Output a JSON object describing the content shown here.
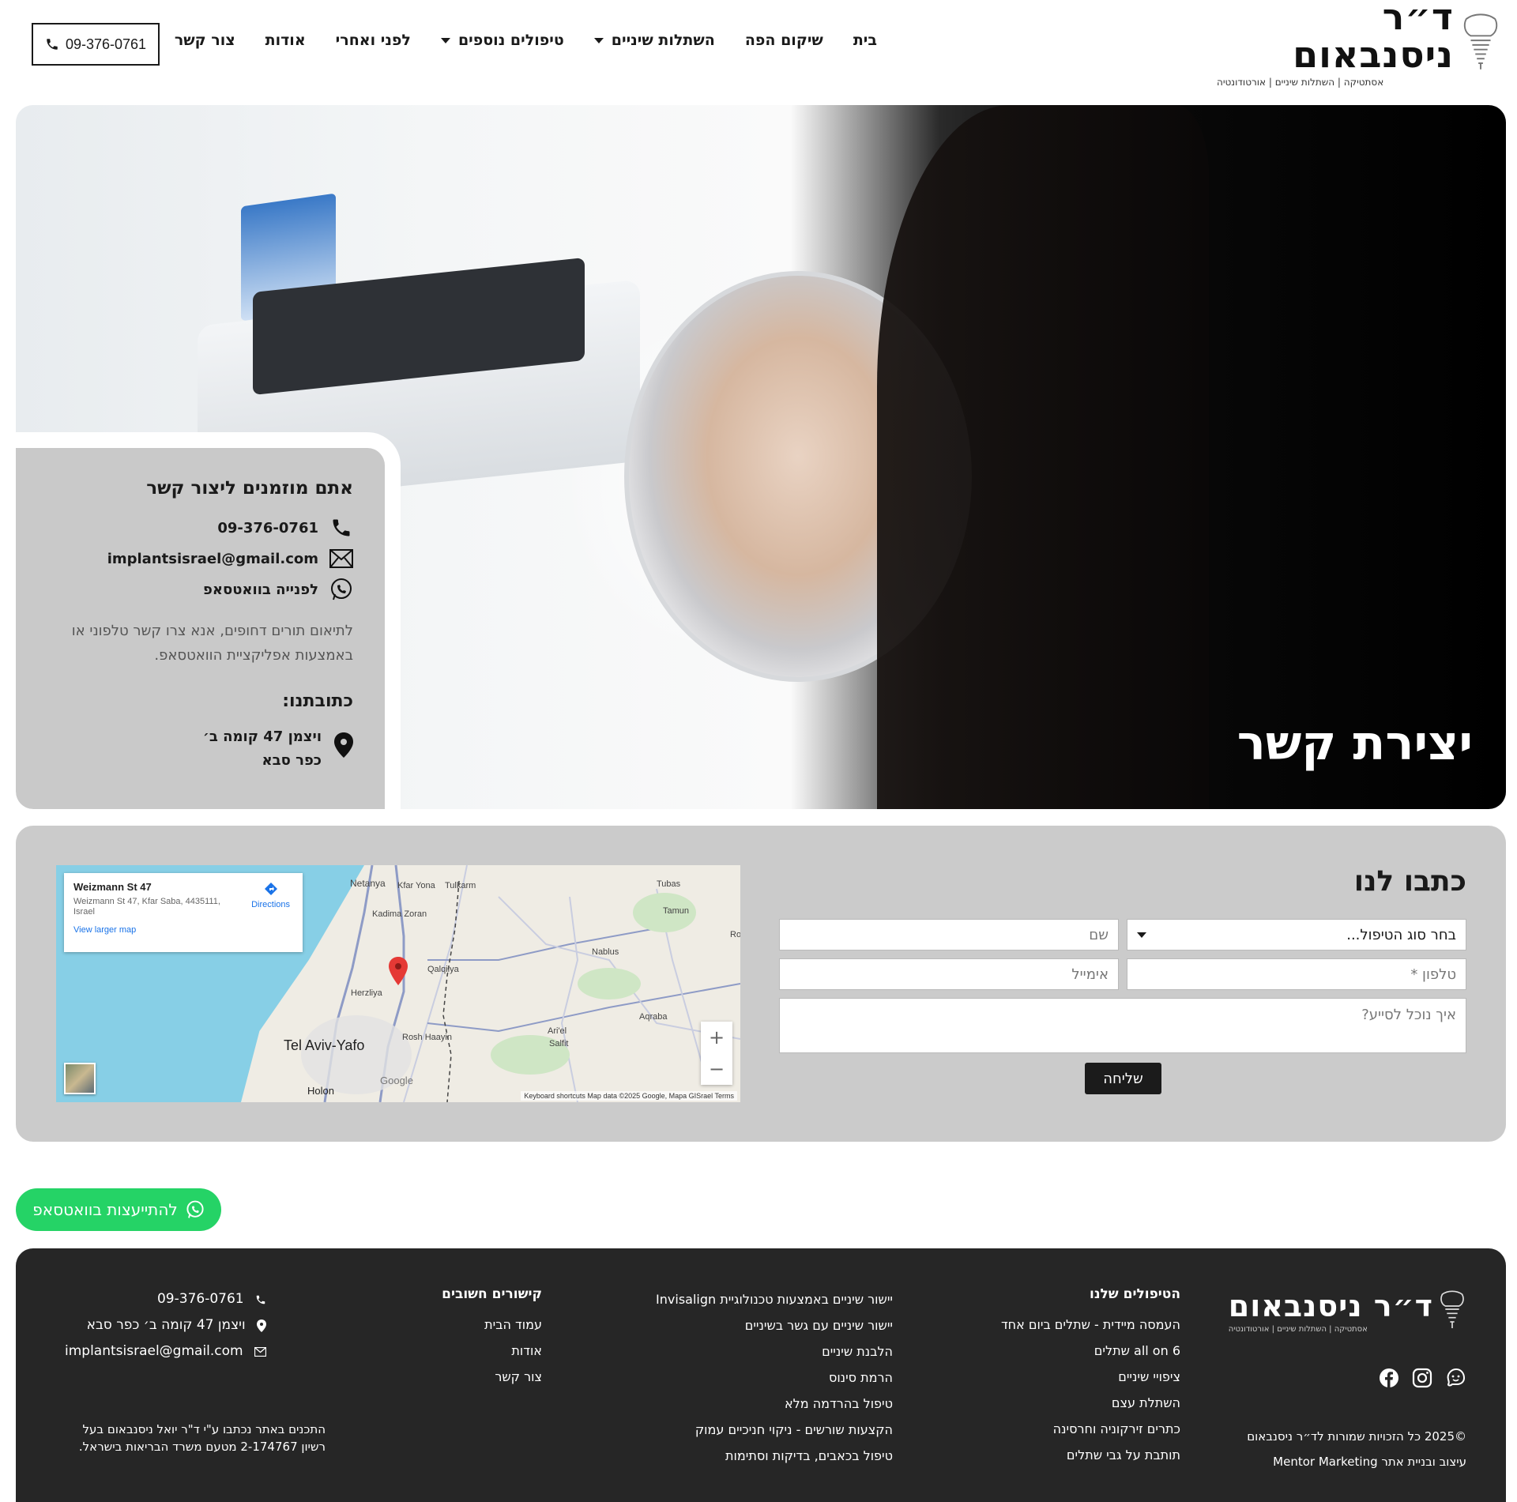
{
  "header": {
    "logo_name": "ד״ר ניסנבאום",
    "logo_tagline": "אסתטיקה | השתלות שיניים | אורטודונטיה",
    "nav": [
      {
        "label": "בית"
      },
      {
        "label": "שיקום הפה"
      },
      {
        "label": "השתלות שיניים"
      },
      {
        "label": "טיפולים נוספים"
      },
      {
        "label": "לפני ואחרי"
      },
      {
        "label": "אודות"
      },
      {
        "label": "צור קשר"
      }
    ],
    "phone": "09-376-0761"
  },
  "hero": {
    "title": "יצירת קשר"
  },
  "contact_card": {
    "title": "אתם מוזמנים ליצור קשר",
    "phone": "09-376-0761",
    "email": "implantsisrael@gmail.com",
    "whatsapp": "לפנייה בוואטסאפ",
    "note": "לתיאום תורים דחופים, אנא צרו קשר טלפוני או באמצעות אפליקציית הוואטסאפ.",
    "address_title": "כתובתנו:",
    "address_line1": "ויצמן 47 קומה ב׳",
    "address_line2": "כפר סבא"
  },
  "form": {
    "title": "כתבו לנו",
    "treatment_select": "בחר סוג הטיפול...",
    "name_placeholder": "שם",
    "phone_placeholder": "טלפון *",
    "email_placeholder": "אימייל",
    "message_placeholder": "איך נוכל לסייע?",
    "submit_label": "שליחה"
  },
  "map": {
    "place_title": "Weizmann St 47",
    "place_address": "Weizmann St 47, Kfar Saba, 4435111, Israel",
    "directions_label": "Directions",
    "larger_map_label": "View larger map",
    "towns": {
      "netanya": "Netanya",
      "kfar_yona": "Kfar Yona",
      "tulkarm": "Tulkarm",
      "tubas": "Tubas",
      "tamun": "Tamun",
      "kadima": "Kadima Zoran",
      "qalqilya": "Qalqilya",
      "nablus": "Nablus",
      "herzliya": "Herzliya",
      "tel_aviv": "Tel Aviv-Yafo",
      "rosh_haayin": "Rosh Haayin",
      "ariel": "Ari'el",
      "salfit": "Salfit",
      "aqraba": "Aqraba",
      "holon": "Holon",
      "ro": "Ro"
    },
    "google_label": "Google",
    "attribution": "Keyboard shortcuts   Map data ©2025 Google, Mapa GISrael   Terms",
    "zoom_in": "+",
    "zoom_out": "−"
  },
  "whatsapp_button": {
    "label": "להתייעצות בוואטסאפ"
  },
  "footer": {
    "logo_name": "ד״ר ניסנבאום",
    "logo_tagline": "אסתטיקה | השתלות שיניים | אורטודונטיה",
    "copyright": "©2025 כל הזכויות שמורות לד״ר ניסנבאום",
    "credit": "עיצוב ובניית אתר Mentor Marketing",
    "treatments_title": "הטיפולים שלנו",
    "treatments": [
      "העמסה מיידית - שתלים ביום אחד",
      "all on 6 שתלים",
      "ציפויי שיניים",
      "השתלת עצם",
      "כתרים זירקוניה וחרסינה",
      "תותבת על גבי שתלים"
    ],
    "treatments_more": [
      "יישור שיניים באמצעות טכנולוגיית Invisalign",
      "יישור שיניים עם גשר בשיניים",
      "הלבנת שיניים",
      "הרמת סינוס",
      "טיפול בהרדמה מלא",
      "הקצעות שורשים - ניקוי חניכיים עמוק",
      "טיפול בכאבים, בדיקות וסתימות"
    ],
    "links_title": "קישורים חשובים",
    "links": [
      "עמוד הבית",
      "אודות",
      "צור קשר"
    ],
    "phone": "09-376-0761",
    "address": "ויצמן 47 קומה ב׳ כפר סבא",
    "email": "implantsisrael@gmail.com",
    "disclaimer": "התכנים באתר נכתבו ע\"י ד\"ר יואל ניסנבאום בעל רשיון 2-174767 מטעם משרד הבריאות בישראל."
  },
  "colors": {
    "accent_dark": "#1b1b1b",
    "panel_gray": "#c9c9c9",
    "footer_bg": "#262626",
    "whatsapp_green": "#25d366"
  }
}
